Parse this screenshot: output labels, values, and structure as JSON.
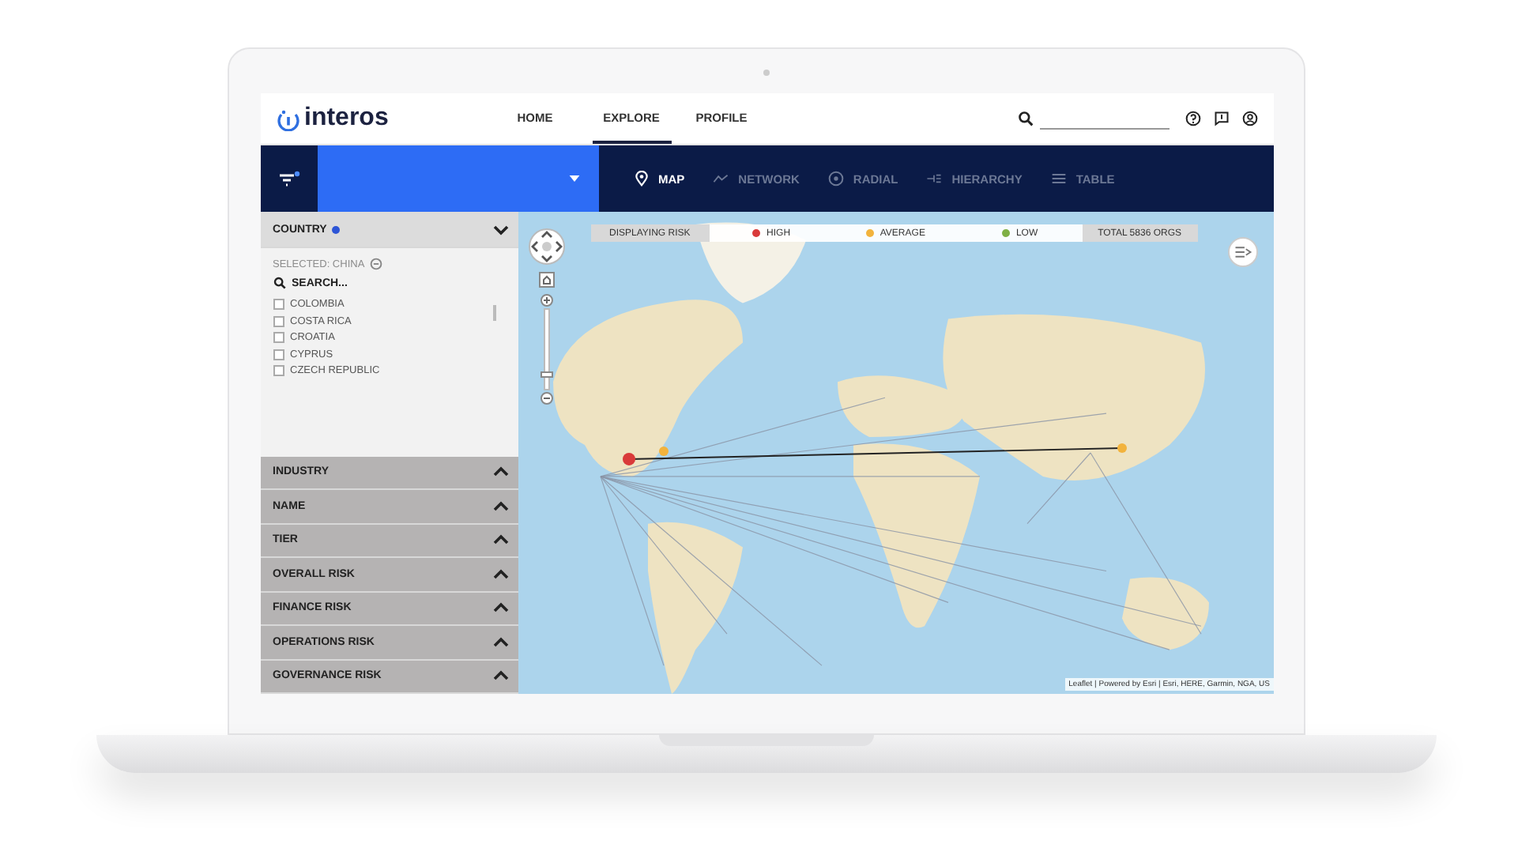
{
  "brand": {
    "name": "interos"
  },
  "nav": {
    "tabs": [
      {
        "label": "HOME",
        "selected": false
      },
      {
        "label": "EXPLORE",
        "selected": true
      },
      {
        "label": "PROFILE",
        "selected": false
      }
    ]
  },
  "toolbar": {
    "views": [
      {
        "kind": "map",
        "label": "MAP",
        "selected": true
      },
      {
        "kind": "network",
        "label": "NETWORK",
        "selected": false
      },
      {
        "kind": "radial",
        "label": "RADIAL",
        "selected": false
      },
      {
        "kind": "hierarchy",
        "label": "HIERARCHY",
        "selected": false
      },
      {
        "kind": "table",
        "label": "TABLE",
        "selected": false
      }
    ]
  },
  "sidebar": {
    "country": {
      "label": "COUNTRY",
      "expanded": true,
      "selected_text": "SELECTED: CHINA",
      "search_placeholder": "SEARCH...",
      "items": [
        {
          "label": "COLOMBIA",
          "checked": false
        },
        {
          "label": "COSTA RICA",
          "checked": false
        },
        {
          "label": "CROATIA",
          "checked": false
        },
        {
          "label": "CYPRUS",
          "checked": false
        },
        {
          "label": "CZECH REPUBLIC",
          "checked": false
        }
      ]
    },
    "sections": [
      {
        "label": "INDUSTRY",
        "expanded": false
      },
      {
        "label": "NAME",
        "expanded": false
      },
      {
        "label": "TIER",
        "expanded": false
      },
      {
        "label": "OVERALL RISK",
        "expanded": false
      },
      {
        "label": "FINANCE RISK",
        "expanded": false
      },
      {
        "label": "OPERATIONS RISK",
        "expanded": false
      },
      {
        "label": "GOVERNANCE RISK",
        "expanded": false
      }
    ]
  },
  "legend": {
    "title": "DISPLAYING RISK",
    "levels": [
      {
        "label": "HIGH",
        "color": "#d93a3a"
      },
      {
        "label": "AVERAGE",
        "color": "#f2b33d"
      },
      {
        "label": "LOW",
        "color": "#7fb045"
      }
    ],
    "total": "TOTAL 5836 ORGS"
  },
  "map": {
    "zoom": {
      "level": 0.15
    },
    "attribution": "Leaflet | Powered by Esri | Esri, HERE, Garmin, NGA, US"
  }
}
